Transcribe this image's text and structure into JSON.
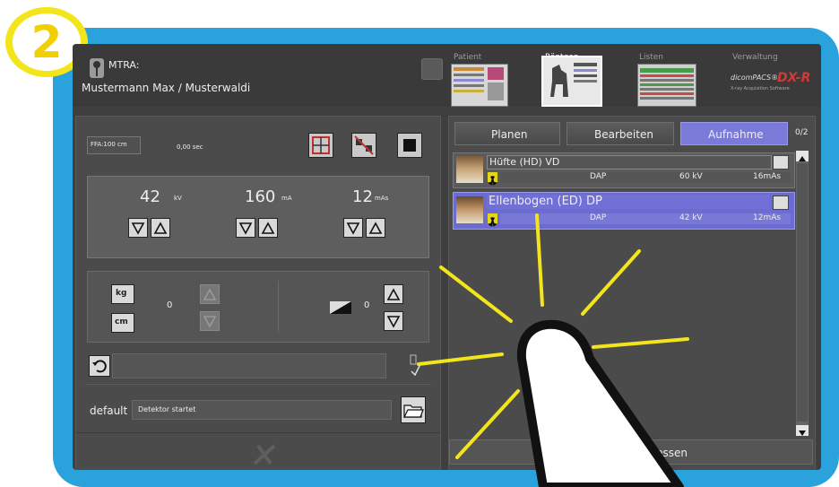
{
  "step_badge": "2",
  "user": {
    "role_label": "MTRA:",
    "name": "Mustermann Max / Musterwaldi"
  },
  "nav": [
    {
      "label": "Patient"
    },
    {
      "label": "Röntgen"
    },
    {
      "label": "Listen"
    },
    {
      "label": "Verwaltung"
    }
  ],
  "logo": {
    "text1": "dicomPACS®",
    "text2": "DX-R",
    "tagline": "X-ray Acquisition Software"
  },
  "exposure": {
    "ffa": "FFA:100 cm",
    "time": "0,00 sec",
    "kv": {
      "value": "42",
      "unit": "kV"
    },
    "ma": {
      "value": "160",
      "unit": "mA"
    },
    "mas": {
      "value": "12",
      "unit": "mAs"
    }
  },
  "patient_params": {
    "kg_label": "kg",
    "cm_label": "cm",
    "kg_cm_value": "0",
    "density_value": "0"
  },
  "status": {
    "preset": "default",
    "message": "Detektor startet"
  },
  "tabs": [
    {
      "label": "Planen"
    },
    {
      "label": "Bearbeiten"
    },
    {
      "label": "Aufnahme"
    }
  ],
  "count": "0/2",
  "exams": [
    {
      "title": "Hüfte (HD) VD",
      "dap": "DAP",
      "kv": "60 kV",
      "mas": "16mAs"
    },
    {
      "title": "Ellenbogen (ED) DP",
      "dap": "DAP",
      "kv": "42 kV",
      "mas": "12mAs"
    }
  ],
  "footer_button": "abschliessen",
  "colors": {
    "frame": "#2aa3dc",
    "accent": "#7a7ad8",
    "badge": "#f2e51b",
    "selected_row": "#6b6bd0"
  }
}
